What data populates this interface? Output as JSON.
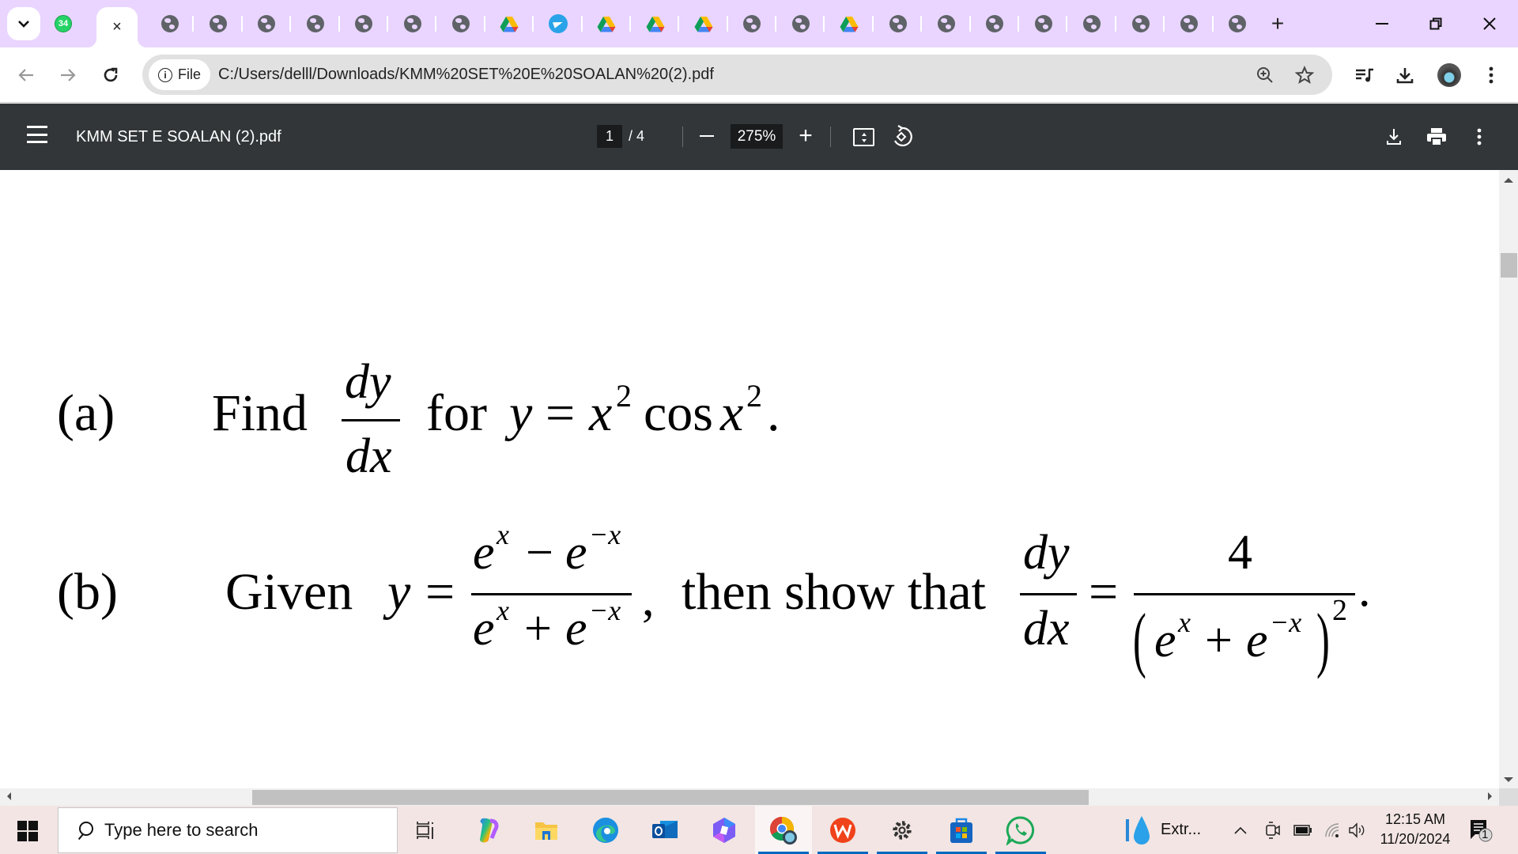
{
  "browser": {
    "tab_search_label": "Search tabs",
    "whatsapp_badge": "34",
    "active_tab_close": "×",
    "tabs": [
      {
        "icon": "globe-icon"
      },
      {
        "icon": "globe-icon"
      },
      {
        "icon": "globe-icon"
      },
      {
        "icon": "globe-icon"
      },
      {
        "icon": "globe-icon"
      },
      {
        "icon": "globe-icon"
      },
      {
        "icon": "globe-icon"
      },
      {
        "icon": "google-drive-icon"
      },
      {
        "icon": "telegram-icon"
      },
      {
        "icon": "google-drive-icon"
      },
      {
        "icon": "google-drive-icon"
      },
      {
        "icon": "google-drive-icon"
      },
      {
        "icon": "globe-icon"
      },
      {
        "icon": "globe-icon"
      },
      {
        "icon": "google-drive-icon"
      },
      {
        "icon": "globe-icon"
      },
      {
        "icon": "globe-icon"
      },
      {
        "icon": "globe-icon"
      },
      {
        "icon": "globe-icon"
      },
      {
        "icon": "globe-icon"
      },
      {
        "icon": "globe-icon"
      },
      {
        "icon": "globe-icon"
      },
      {
        "icon": "globe-icon"
      }
    ],
    "new_tab": "+",
    "window": {
      "minimize": "—",
      "restore": "❐",
      "close": "✕"
    },
    "nav": {
      "back": "←",
      "forward": "→",
      "reload": "↻"
    },
    "address": {
      "scheme_chip": "File",
      "info_glyph": "i",
      "url": "C:/Users/delll/Downloads/KMM%20SET%20E%20SOALAN%20(2).pdf"
    }
  },
  "pdf_viewer": {
    "title": "KMM SET E SOALAN (2).pdf",
    "current_page": "1",
    "total_pages": "/  4",
    "zoom": "275%",
    "zoom_in": "+",
    "rotate_glyph": "⟲",
    "download_glyph": "⤓",
    "print_glyph": "🖶",
    "more_glyph": "⋮"
  },
  "document": {
    "part_a": {
      "label": "(a)",
      "find": "Find",
      "dy": "dy",
      "dx": "dx",
      "for": "for",
      "equation_y": "y",
      "equals": "=",
      "x": "x",
      "exp": "2",
      "cos": "cos",
      "x2": "x",
      "exp2": "2",
      "period": "."
    },
    "part_b": {
      "label": "(b)",
      "given": "Given",
      "y": "y",
      "equals": "=",
      "num_e1": "e",
      "num_x1": "x",
      "num_minus": "−",
      "num_e2": "e",
      "num_x2": "−x",
      "den_e1": "e",
      "den_x1": "x",
      "den_plus": "+",
      "den_e2": "e",
      "den_x2": "−x",
      "comma": ",",
      "then_show": "then show that",
      "dy": "dy",
      "dx": "dx",
      "equals2": "=",
      "four": "4",
      "rhs_e1": "e",
      "rhs_x1": "x",
      "rhs_plus": "+",
      "rhs_e2": "e",
      "rhs_x2": "−x",
      "lparen": "(",
      "rparen": ")",
      "power": "2",
      "period": "."
    }
  },
  "taskbar": {
    "search_placeholder": "Type here to search",
    "apps": [
      "task-view",
      "copilot",
      "file-explorer",
      "edge",
      "outlook",
      "microsoft-365",
      "chrome",
      "wps-office",
      "settings",
      "microsoft-store",
      "whatsapp"
    ],
    "tray_app_label": "Extr...",
    "time": "12:15 AM",
    "date": "11/20/2024",
    "notification_count": "1"
  }
}
